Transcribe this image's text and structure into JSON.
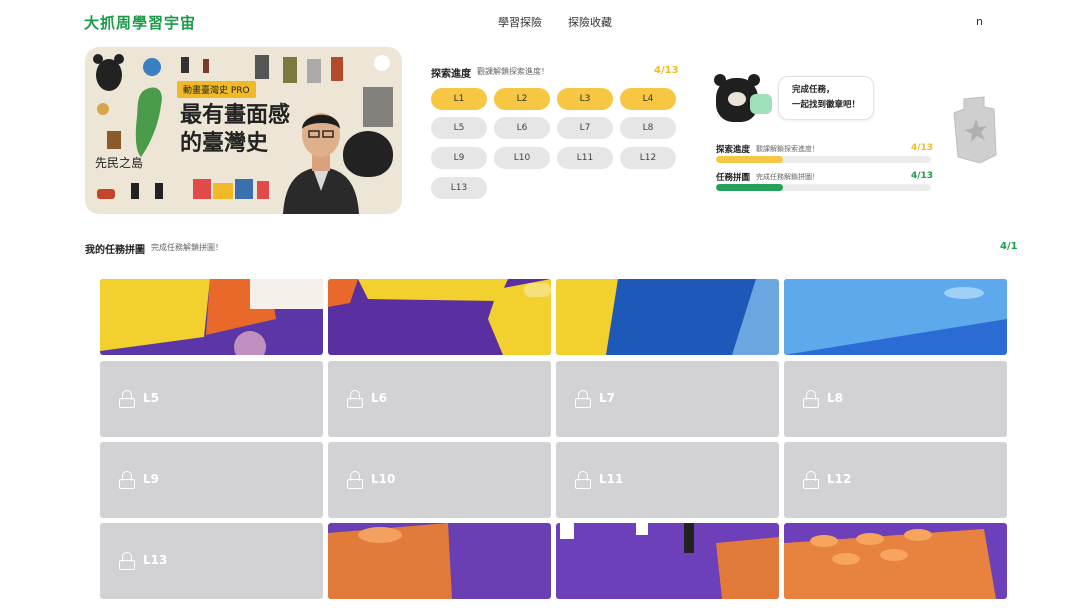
{
  "header": {
    "logo": "大抓周學習宇宙",
    "nav": [
      "學習探險",
      "探險收藏"
    ],
    "user": "n"
  },
  "course": {
    "tag": "動畫臺灣史 PRO",
    "title": "最有畫面感的臺灣史"
  },
  "progress": {
    "title": "探索進度",
    "subtitle": "觀課解鎖探索進度！",
    "count": "4/13",
    "lessons": [
      {
        "label": "L1",
        "done": true
      },
      {
        "label": "L2",
        "done": true
      },
      {
        "label": "L3",
        "done": true
      },
      {
        "label": "L4",
        "done": true
      },
      {
        "label": "L5",
        "done": false
      },
      {
        "label": "L6",
        "done": false
      },
      {
        "label": "L7",
        "done": false
      },
      {
        "label": "L8",
        "done": false
      },
      {
        "label": "L9",
        "done": false
      },
      {
        "label": "L10",
        "done": false
      },
      {
        "label": "L11",
        "done": false
      },
      {
        "label": "L12",
        "done": false
      },
      {
        "label": "L13",
        "done": false
      }
    ]
  },
  "mission": {
    "bubble_line1": "完成任務，",
    "bubble_line2": "一起找到徽章吧！",
    "explore_label": "探索進度",
    "explore_sub": "觀課解鎖探索進度！",
    "explore_count": "4/13",
    "explore_fraction": 0.31,
    "puzzle_label": "任務拼圖",
    "puzzle_sub": "完成任務解鎖拼圖！",
    "puzzle_count": "4/13",
    "puzzle_fraction": 0.31,
    "colors": {
      "explore": "#f7c744",
      "puzzle": "#24a05a"
    }
  },
  "puzzle": {
    "title": "我的任務拼圖",
    "subtitle": "完成任務解鎖拼圖！",
    "count": "4/1",
    "locked_tiles": [
      "L5",
      "L6",
      "L7",
      "L8",
      "L9",
      "L10",
      "L11",
      "L12",
      "L13"
    ]
  }
}
